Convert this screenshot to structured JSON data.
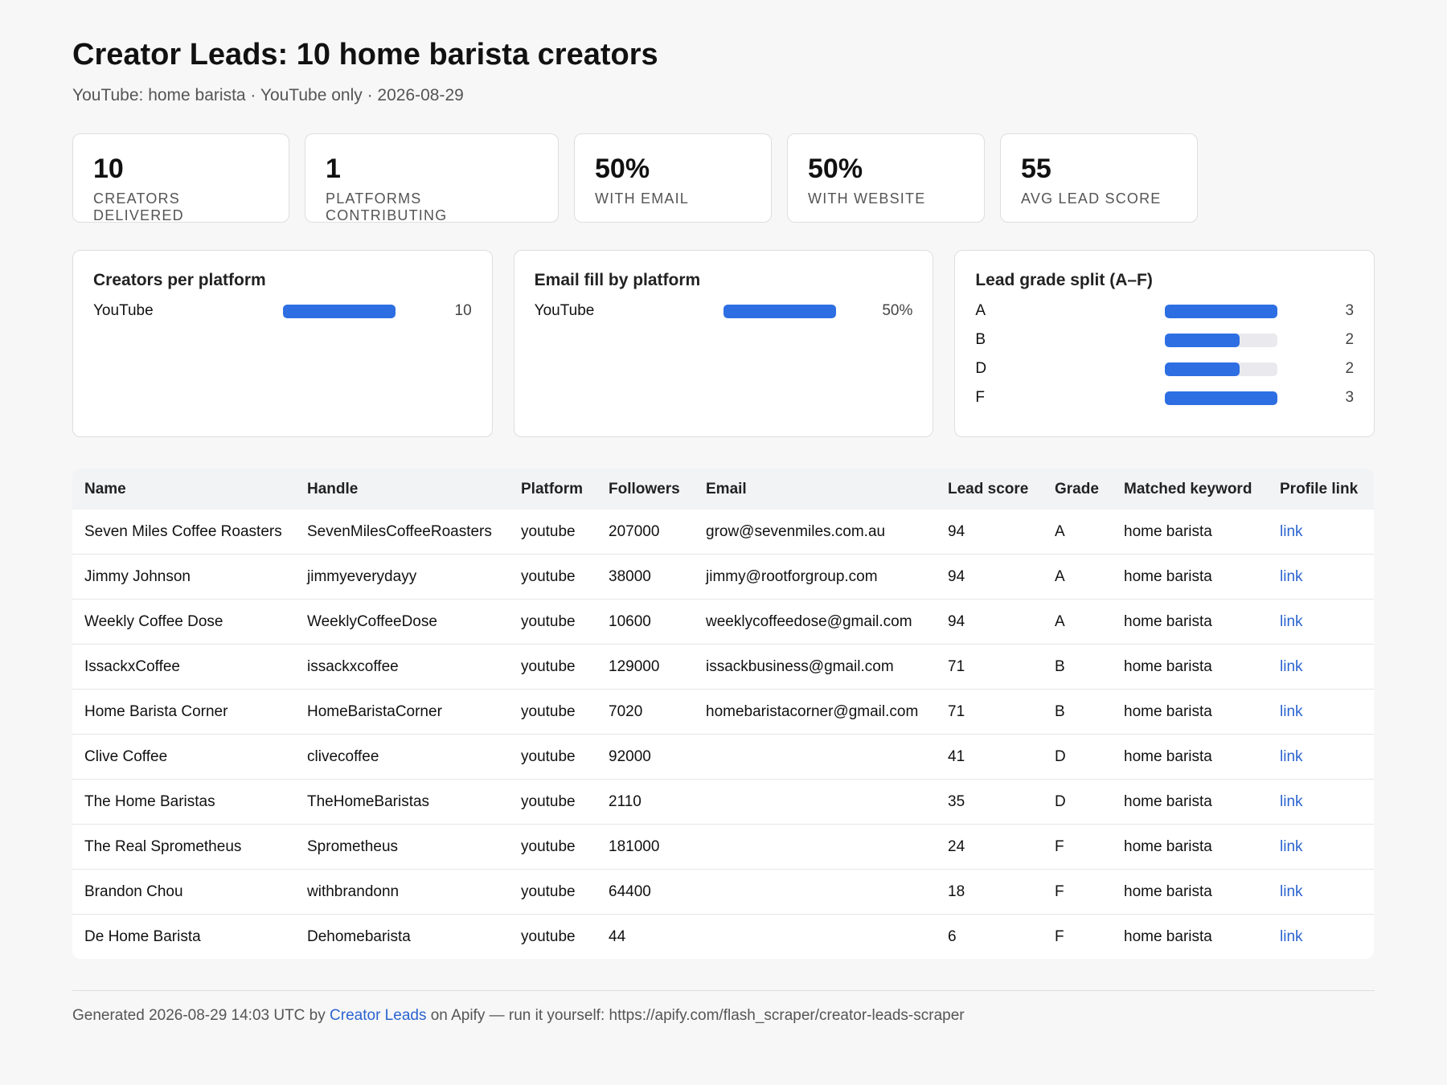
{
  "header": {
    "title": "Creator Leads: 10 home barista creators",
    "subtitle": "YouTube: home barista · YouTube only · 2026-08-29"
  },
  "kpis": [
    {
      "value": "10",
      "label": "Creators delivered"
    },
    {
      "value": "1",
      "label": "Platforms contributing"
    },
    {
      "value": "50%",
      "label": "With email"
    },
    {
      "value": "50%",
      "label": "With website"
    },
    {
      "value": "55",
      "label": "Avg lead score"
    }
  ],
  "panels": {
    "creators_per_platform": {
      "title": "Creators per platform",
      "rows": [
        {
          "label": "YouTube",
          "value": "10",
          "fraction": 1.0
        }
      ]
    },
    "email_fill": {
      "title": "Email fill by platform",
      "rows": [
        {
          "label": "YouTube",
          "value": "50%",
          "fraction": 1.0
        }
      ]
    },
    "grade_split": {
      "title": "Lead grade split (A–F)",
      "rows": [
        {
          "label": "A",
          "value": "3",
          "fraction": 1.0
        },
        {
          "label": "B",
          "value": "2",
          "fraction": 0.667
        },
        {
          "label": "D",
          "value": "2",
          "fraction": 0.667
        },
        {
          "label": "F",
          "value": "3",
          "fraction": 1.0
        }
      ]
    }
  },
  "table": {
    "columns": [
      "Name",
      "Handle",
      "Platform",
      "Followers",
      "Email",
      "Lead score",
      "Grade",
      "Matched keyword",
      "Profile link"
    ],
    "rows": [
      [
        "Seven Miles Coffee Roasters",
        "SevenMilesCoffeeRoasters",
        "youtube",
        "207000",
        "grow@sevenmiles.com.au",
        "94",
        "A",
        "home barista",
        "link"
      ],
      [
        "Jimmy Johnson",
        "jimmyeverydayy",
        "youtube",
        "38000",
        "jimmy@rootforgroup.com",
        "94",
        "A",
        "home barista",
        "link"
      ],
      [
        "Weekly Coffee Dose",
        "WeeklyCoffeeDose",
        "youtube",
        "10600",
        "weeklycoffeedose@gmail.com",
        "94",
        "A",
        "home barista",
        "link"
      ],
      [
        "IssackxCoffee",
        "issackxcoffee",
        "youtube",
        "129000",
        "issackbusiness@gmail.com",
        "71",
        "B",
        "home barista",
        "link"
      ],
      [
        "Home Barista Corner",
        "HomeBaristaCorner",
        "youtube",
        "7020",
        "homebaristacorner@gmail.com",
        "71",
        "B",
        "home barista",
        "link"
      ],
      [
        "Clive Coffee",
        "clivecoffee",
        "youtube",
        "92000",
        "",
        "41",
        "D",
        "home barista",
        "link"
      ],
      [
        "The Home Baristas",
        "TheHomeBaristas",
        "youtube",
        "2110",
        "",
        "35",
        "D",
        "home barista",
        "link"
      ],
      [
        "The Real Sprometheus",
        "Sprometheus",
        "youtube",
        "181000",
        "",
        "24",
        "F",
        "home barista",
        "link"
      ],
      [
        "Brandon Chou",
        "withbrandonn",
        "youtube",
        "64400",
        "",
        "18",
        "F",
        "home barista",
        "link"
      ],
      [
        "De Home Barista",
        "Dehomebarista",
        "youtube",
        "44",
        "",
        "6",
        "F",
        "home barista",
        "link"
      ]
    ]
  },
  "footer": {
    "prefix": "Generated 2026-08-29 14:03 UTC by",
    "brand": "Creator Leads",
    "suffix": "on Apify — run it yourself: https://apify.com/flash_scraper/creator-leads-scraper"
  },
  "colors": {
    "accent": "#2d6fe3",
    "link": "#2b64cf",
    "track": "#eaeaee"
  }
}
